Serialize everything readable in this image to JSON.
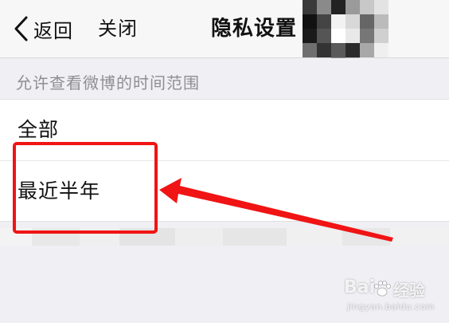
{
  "nav": {
    "back_label": "返回",
    "close_label": "关闭",
    "title": "隐私设置"
  },
  "section": {
    "label": "允许查看微博的时间范围"
  },
  "options": [
    {
      "label": "全部"
    },
    {
      "label": "最近半年"
    }
  ],
  "annotation": {
    "color": "#f01414"
  },
  "watermark": {
    "brand_left": "Bai",
    "brand_right": "经验",
    "url": "jingyan.baidu.com"
  }
}
